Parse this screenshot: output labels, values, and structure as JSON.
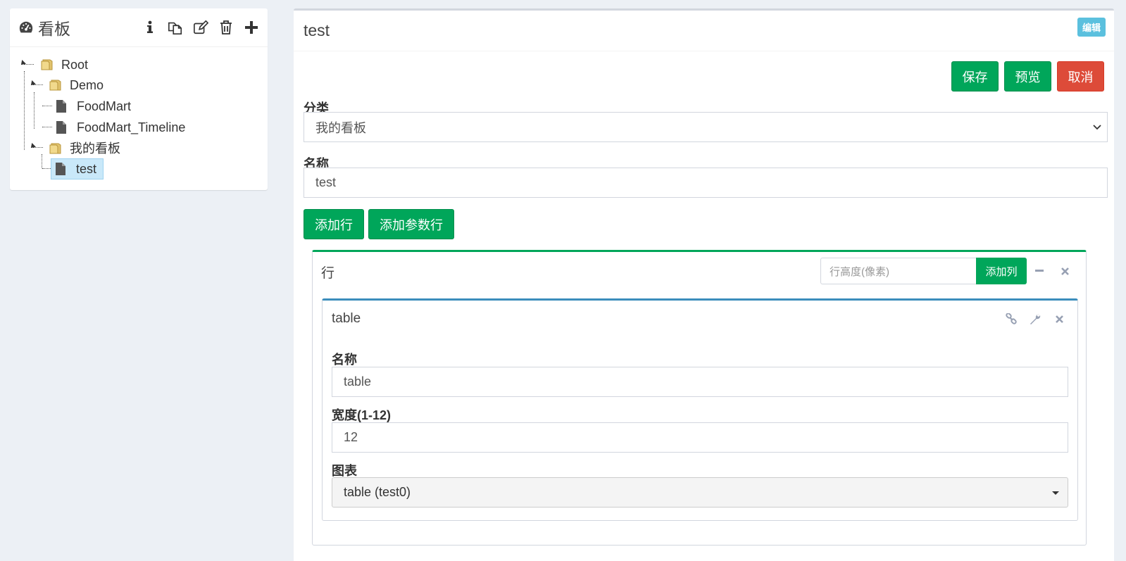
{
  "left": {
    "title": "看板",
    "tools": [
      "info-icon",
      "copy-icon",
      "edit-icon",
      "trash-icon",
      "plus-icon"
    ],
    "tree": {
      "root": "Root",
      "demo": "Demo",
      "foodmart": "FoodMart",
      "foodmart_timeline": "FoodMart_Timeline",
      "my_boards": "我的看板",
      "test": "test"
    }
  },
  "right": {
    "title": "test",
    "edit_badge": "编辑",
    "save": "保存",
    "preview": "预览",
    "cancel": "取消",
    "category_label": "分类",
    "category_value": "我的看板",
    "name_label": "名称",
    "name_value": "test",
    "add_row": "添加行",
    "add_param_row": "添加参数行",
    "row": {
      "title": "行",
      "height_placeholder": "行高度(像素)",
      "add_column": "添加列",
      "column": {
        "title": "table",
        "name_label": "名称",
        "name_value": "table",
        "width_label": "宽度(1-12)",
        "width_value": "12",
        "chart_label": "图表",
        "chart_value": "table (test0)"
      }
    }
  },
  "colors": {
    "green": "#00a65a",
    "red": "#dd4b39",
    "blue": "#3c8dbc",
    "info": "#5bc0de",
    "background": "#ecf0f5"
  }
}
